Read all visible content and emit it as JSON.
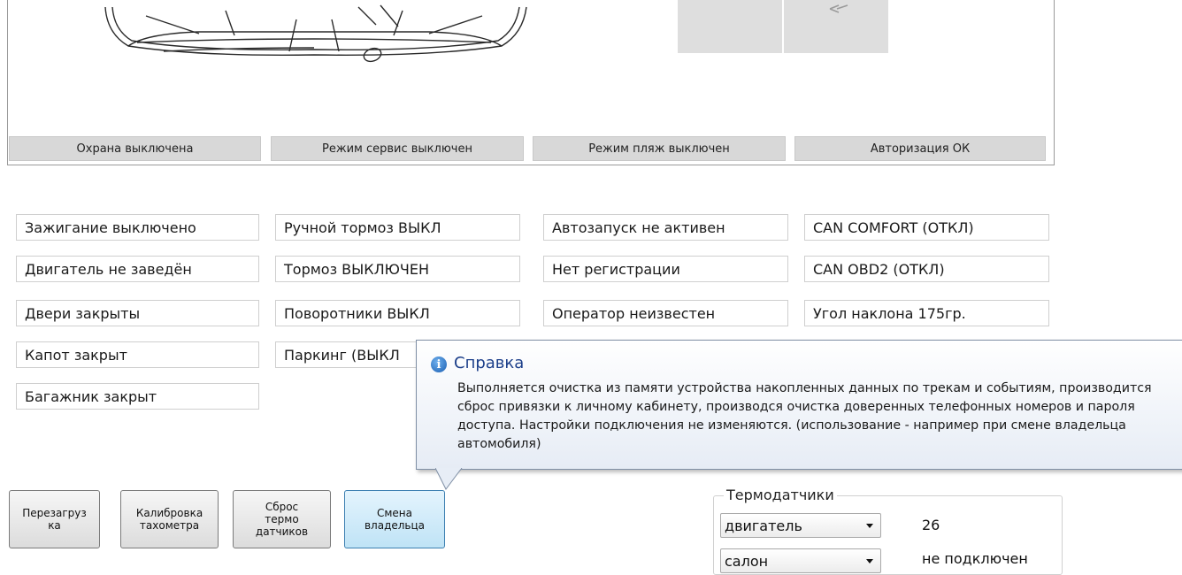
{
  "status_bar": [
    "Охрана выключена",
    "Режим сервис выключен",
    "Режим пляж выключен",
    "Авторизация ОК"
  ],
  "status_columns": [
    [
      "Зажигание выключено",
      "Двигатель не заведён",
      "Двери закрыты",
      "Капот закрыт",
      "Багажник закрыт"
    ],
    [
      "Ручной тормоз ВЫКЛ",
      "Тормоз ВЫКЛЮЧЕН",
      "Поворотники ВЫКЛ",
      "Паркинг (ВЫКЛ"
    ],
    [
      "Автозапуск не активен",
      "Нет регистрации",
      "Оператор неизвестен"
    ],
    [
      "CAN COMFORT (ОТКЛ)",
      "CAN OBD2 (ОТКЛ)",
      "Угол наклона 175гр."
    ]
  ],
  "buttons": [
    "Перезагруз\nка",
    "Калибровка\nтахометра",
    "Сброс\nтермо\nдатчиков",
    "Смена\nвладельца"
  ],
  "tooltip": {
    "icon": "info-icon",
    "title": "Справка",
    "text": "Выполняется очистка из памяти устройства накопленных данных по трекам и событиям, производится сброс привязки к личному кабинету, производся очистка доверенных телефонных номеров и пароля доступа. Настройки подключения не изменяются.  (использование - например при смене владельца автомобиля)"
  },
  "thermo": {
    "legend": "Термодатчики",
    "rows": [
      {
        "select": "двигатель",
        "value": "26"
      },
      {
        "select": "салон",
        "value": "не подключен"
      }
    ]
  },
  "colors": {
    "tooltip_title": "#1c3f8a",
    "active_button": "#bfe3f6",
    "status_bar_bg": "#d8d8d8"
  }
}
